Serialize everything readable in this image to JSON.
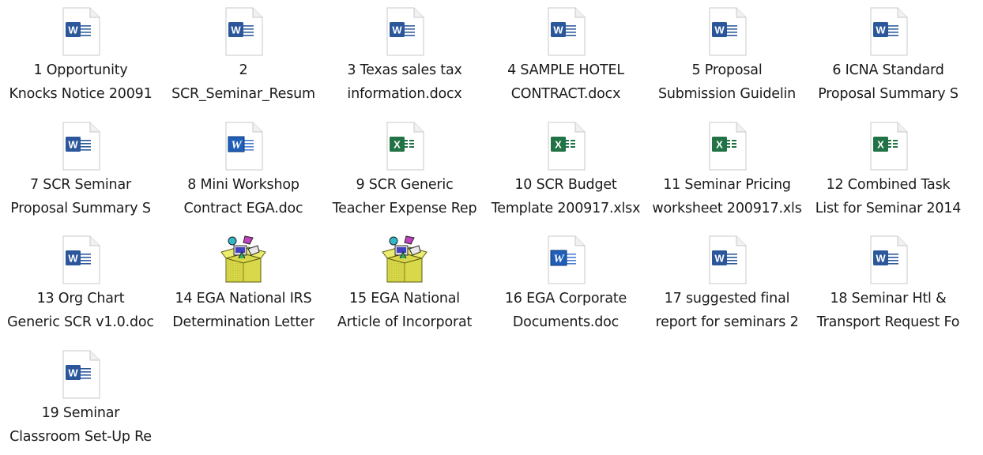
{
  "window": {
    "view": "large-icons"
  },
  "colors": {
    "word": "#2b579a",
    "word_old": "#1f5fb8",
    "excel": "#217346",
    "package": "#d8d84a"
  },
  "files": [
    {
      "type": "word",
      "line1": "1 Opportunity",
      "line2": "Knocks Notice 20091"
    },
    {
      "type": "word",
      "line1": "2",
      "line2": "SCR_Seminar_Resum"
    },
    {
      "type": "word",
      "line1": "3 Texas sales tax",
      "line2": "information.docx"
    },
    {
      "type": "word",
      "line1": "4 SAMPLE HOTEL",
      "line2": "CONTRACT.docx"
    },
    {
      "type": "word",
      "line1": "5 Proposal",
      "line2": "Submission Guidelin"
    },
    {
      "type": "word",
      "line1": "6 ICNA Standard",
      "line2": "Proposal Summary S"
    },
    {
      "type": "word",
      "line1": "7 SCR Seminar",
      "line2": "Proposal Summary S"
    },
    {
      "type": "word-old",
      "line1": "8 Mini Workshop",
      "line2": "Contract EGA.doc"
    },
    {
      "type": "excel",
      "line1": "9 SCR Generic",
      "line2": "Teacher Expense Rep"
    },
    {
      "type": "excel",
      "line1": "10 SCR Budget",
      "line2": "Template 200917.xlsx"
    },
    {
      "type": "excel",
      "line1": "11 Seminar Pricing",
      "line2": "worksheet 200917.xls"
    },
    {
      "type": "excel",
      "line1": "12 Combined Task",
      "line2": "List for Seminar 2014"
    },
    {
      "type": "word",
      "line1": "13 Org Chart",
      "line2": "Generic SCR v1.0.doc"
    },
    {
      "type": "package",
      "line1": "14 EGA National IRS",
      "line2": "Determination Letter"
    },
    {
      "type": "package",
      "line1": "15 EGA National",
      "line2": "Article of  Incorporat"
    },
    {
      "type": "word-old",
      "line1": "16 EGA Corporate",
      "line2": "Documents.doc"
    },
    {
      "type": "word",
      "line1": "17 suggested final",
      "line2": "report for seminars 2"
    },
    {
      "type": "word",
      "line1": "18 Seminar Htl &",
      "line2": "Transport Request Fo"
    },
    {
      "type": "word",
      "line1": "19 Seminar",
      "line2": "Classroom Set-Up Re"
    }
  ]
}
